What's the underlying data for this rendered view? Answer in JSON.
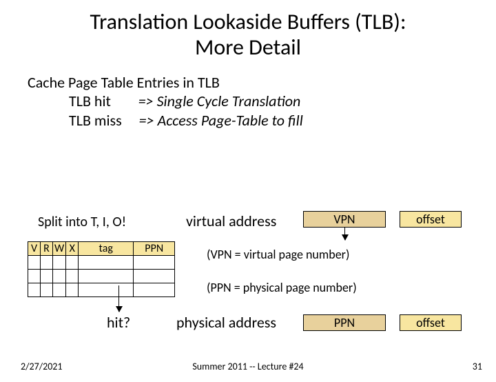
{
  "title_l1": "Translation Lookaside Buffers (TLB):",
  "title_l2": "More Detail",
  "body": {
    "line1": "Cache Page Table Entries in TLB",
    "hit_key": "TLB hit",
    "hit_val": "=> Single Cycle Translation",
    "miss_key": "TLB miss",
    "miss_val": "=> Access Page-Table to fill"
  },
  "labels": {
    "split": "Split into T, I, O!",
    "virtual_address": "virtual address",
    "physical_address": "physical address",
    "hit": "hit?",
    "vpn": "VPN",
    "ppn": "PPN",
    "offset": "offset",
    "vpn_note": "(VPN = virtual page number)",
    "ppn_note": "(PPN = physical page number)"
  },
  "tlb_headers": {
    "v": "V",
    "r": "R",
    "w": "W",
    "x": "X",
    "tag": "tag",
    "ppn": "PPN"
  },
  "footer": {
    "date": "2/27/2021",
    "center": "Summer 2011 -- Lecture #24",
    "page": "31"
  }
}
